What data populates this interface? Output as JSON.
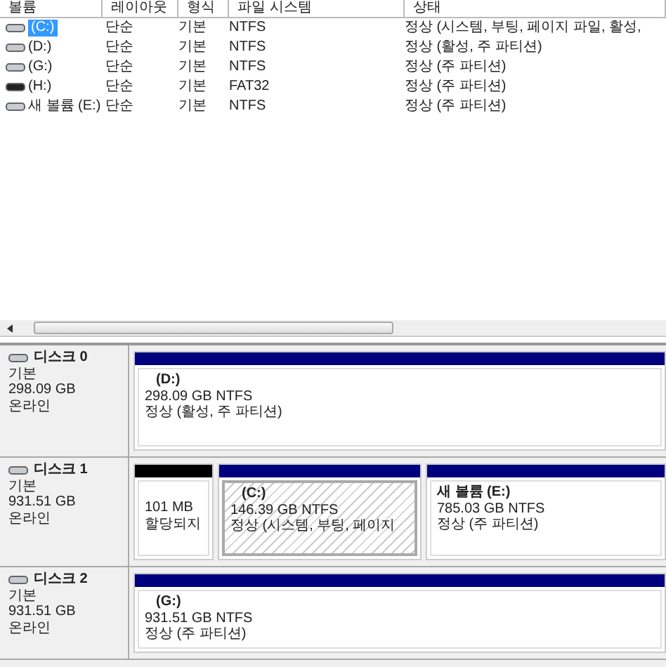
{
  "volume_table": {
    "columns": [
      "볼륨",
      "레이아웃",
      "형식",
      "파일 시스템",
      "상태"
    ],
    "rows": [
      {
        "kind": "disk",
        "volume": "(C:)",
        "layout": "단순",
        "type": "기본",
        "file_system": "NTFS",
        "status": "정상 (시스템, 부팅, 페이지 파일, 활성,",
        "selected": true
      },
      {
        "kind": "disk",
        "volume": "(D:)",
        "layout": "단순",
        "type": "기본",
        "file_system": "NTFS",
        "status": "정상 (활성, 주 파티션)",
        "selected": false
      },
      {
        "kind": "disk",
        "volume": "(G:)",
        "layout": "단순",
        "type": "기본",
        "file_system": "NTFS",
        "status": "정상 (주 파티션)",
        "selected": false
      },
      {
        "kind": "removable",
        "volume": "(H:)",
        "layout": "단순",
        "type": "기본",
        "file_system": "FAT32",
        "status": "정상 (주 파티션)",
        "selected": false
      },
      {
        "kind": "disk",
        "volume": "새 볼륨 (E:)",
        "layout": "단순",
        "type": "기본",
        "file_system": "NTFS",
        "status": "정상 (주 파티션)",
        "selected": false
      }
    ]
  },
  "disks": [
    {
      "name": "디스크 0",
      "type": "기본",
      "size": "298.09 GB",
      "state": "온라인",
      "partitions": [
        {
          "kind": "primary",
          "selected": false,
          "label": "(D:)",
          "size": "298.09 GB NTFS",
          "status": "정상 (활성, 주 파티션)"
        }
      ]
    },
    {
      "name": "디스크 1",
      "type": "기본",
      "size": "931.51 GB",
      "state": "온라인",
      "partitions": [
        {
          "kind": "unallocated",
          "selected": false,
          "size": "101 MB",
          "status": "할당되지"
        },
        {
          "kind": "primary",
          "selected": true,
          "label": "(C:)",
          "size": "146.39 GB NTFS",
          "status": "정상 (시스템, 부팅, 페이지"
        },
        {
          "kind": "primary",
          "selected": false,
          "label": "새 볼륨  (E:)",
          "size": "785.03 GB NTFS",
          "status": "정상 (주 파티션)"
        }
      ]
    },
    {
      "name": "디스크 2",
      "type": "기본",
      "size": "931.51 GB",
      "state": "온라인",
      "partitions": [
        {
          "kind": "primary",
          "selected": false,
          "label": "(G:)",
          "size": "931.51 GB NTFS",
          "status": "정상 (주 파티션)"
        }
      ]
    }
  ]
}
